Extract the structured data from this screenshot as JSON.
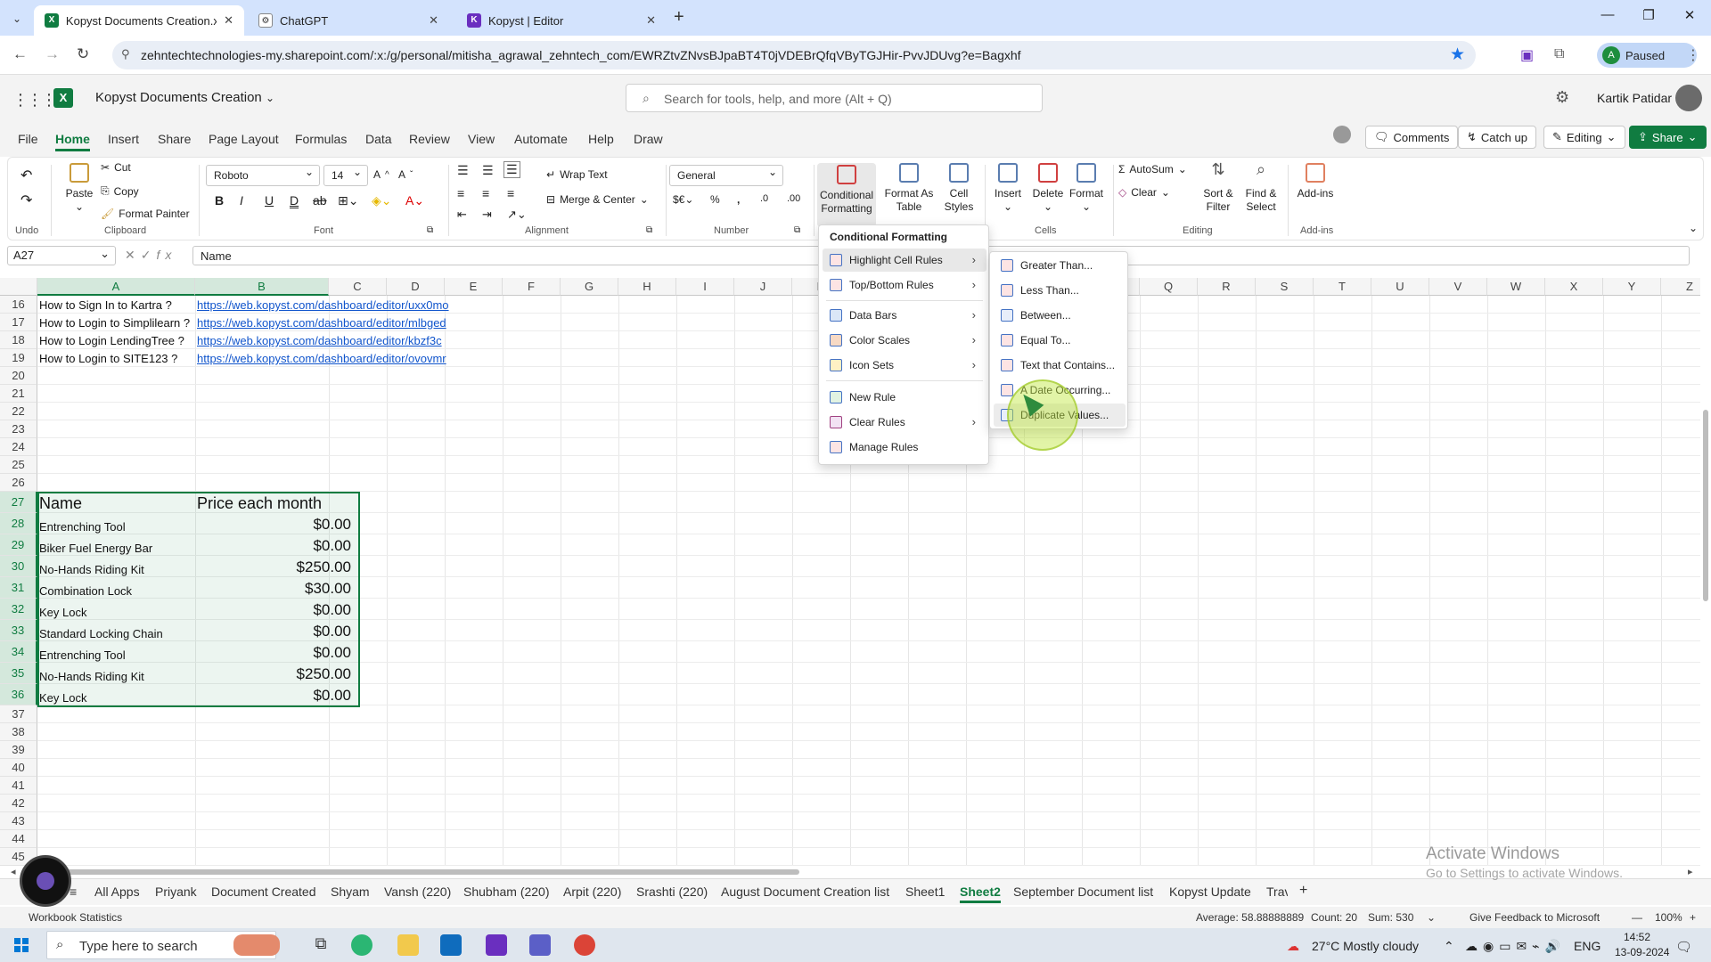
{
  "browser": {
    "tabs": [
      {
        "title": "Kopyst Documents Creation.xlsx",
        "active": true
      },
      {
        "title": "ChatGPT",
        "active": false
      },
      {
        "title": "Kopyst | Editor",
        "active": false
      }
    ],
    "url": "zehntechtechnologies-my.sharepoint.com/:x:/g/personal/mitisha_agrawal_zehntech_com/EWRZtvZNvsBJpaBT4T0jVDEBrQfqVByTGJHir-PvvJDUvg?e=Bagxhf",
    "profile_status": "Paused",
    "profile_initial": "A"
  },
  "app": {
    "title": "Kopyst Documents Creation",
    "search_placeholder": "Search for tools, help, and more (Alt + Q)",
    "user_name": "Kartik Patidar",
    "menu_tabs": [
      "File",
      "Home",
      "Insert",
      "Share",
      "Page Layout",
      "Formulas",
      "Data",
      "Review",
      "View",
      "Automate",
      "Help",
      "Draw"
    ],
    "active_tab": "Home",
    "comments_label": "Comments",
    "catchup_label": "Catch up",
    "editing_label": "Editing",
    "share_label": "Share"
  },
  "ribbon": {
    "undo_group": "Undo",
    "paste": "Paste",
    "cut": "Cut",
    "copy": "Copy",
    "format_painter": "Format Painter",
    "clipboard_group": "Clipboard",
    "font_name": "Roboto",
    "font_size": "14",
    "font_group": "Font",
    "wrap_text": "Wrap Text",
    "merge_center": "Merge & Center",
    "alignment_group": "Alignment",
    "number_format": "General",
    "number_group": "Number",
    "conditional_formatting": "Conditional Formatting",
    "format_as_table": "Format As Table",
    "cell_styles": "Cell Styles",
    "insert": "Insert",
    "delete": "Delete",
    "format": "Format",
    "cells_group": "Cells",
    "autosum": "AutoSum",
    "clear": "Clear",
    "sort_filter": "Sort & Filter",
    "find_select": "Find & Select",
    "editing_group": "Editing",
    "addins": "Add-ins",
    "addins_group": "Add-ins"
  },
  "formula_bar": {
    "name_box": "A27",
    "content": "Name"
  },
  "grid": {
    "columns": [
      "A",
      "B",
      "C",
      "D",
      "E",
      "F",
      "G",
      "H",
      "I",
      "J",
      "K",
      "L",
      "M",
      "N",
      "O",
      "P",
      "Q",
      "R",
      "S",
      "T",
      "U",
      "V",
      "W",
      "X",
      "Y",
      "Z"
    ],
    "rows": [
      "16",
      "17",
      "18",
      "19",
      "20",
      "21",
      "22",
      "23",
      "24",
      "25",
      "26",
      "27",
      "28",
      "29",
      "30",
      "31",
      "32",
      "33",
      "34",
      "35",
      "36",
      "37",
      "38",
      "39",
      "40",
      "41",
      "42",
      "43",
      "44",
      "45"
    ],
    "link_rows": [
      {
        "label": "How to Sign In to Kartra ?",
        "url": "https://web.kopyst.com/dashboard/editor/uxx0mo"
      },
      {
        "label": "How to Login to Simplilearn ?",
        "url": "https://web.kopyst.com/dashboard/editor/mlbged"
      },
      {
        "label": "How to Login LendingTree ?",
        "url": "https://web.kopyst.com/dashboard/editor/kbzf3c"
      },
      {
        "label": "How to Login to SITE123 ?",
        "url": "https://web.kopyst.com/dashboard/editor/ovovmr"
      }
    ],
    "table_header": {
      "name": "Name",
      "price": "Price each month"
    },
    "table_rows": [
      {
        "name": "Entrenching Tool",
        "price": "$0.00"
      },
      {
        "name": "Biker Fuel Energy Bar",
        "price": "$0.00"
      },
      {
        "name": "No-Hands Riding Kit",
        "price": "$250.00"
      },
      {
        "name": "Combination Lock",
        "price": "$30.00"
      },
      {
        "name": "Key Lock",
        "price": "$0.00"
      },
      {
        "name": "Standard Locking Chain",
        "price": "$0.00"
      },
      {
        "name": "Entrenching Tool",
        "price": "$0.00"
      },
      {
        "name": "No-Hands Riding Kit",
        "price": "$250.00"
      },
      {
        "name": "Key Lock",
        "price": "$0.00"
      }
    ]
  },
  "cf_menu": {
    "header": "Conditional Formatting",
    "items": [
      {
        "label": "Highlight Cell Rules",
        "submenu": true
      },
      {
        "label": "Top/Bottom Rules",
        "submenu": true
      },
      {
        "label": "Data Bars",
        "submenu": true
      },
      {
        "label": "Color Scales",
        "submenu": true
      },
      {
        "label": "Icon Sets",
        "submenu": true
      },
      {
        "label": "New Rule",
        "submenu": false
      },
      {
        "label": "Clear Rules",
        "submenu": true
      },
      {
        "label": "Manage Rules",
        "submenu": false
      }
    ]
  },
  "highlight_submenu": {
    "items": [
      "Greater Than...",
      "Less Than...",
      "Between...",
      "Equal To...",
      "Text that Contains...",
      "A Date Occurring...",
      "Duplicate Values..."
    ]
  },
  "sheets": {
    "tabs": [
      "All Apps",
      "Priyank",
      "Document Created",
      "Shyam",
      "Vansh (220)",
      "Shubham (220)",
      "Arpit (220)",
      "Srashti (220)",
      "August Document Creation list",
      "Sheet1",
      "Sheet2",
      "September Document list",
      "Kopyst Update",
      "Trav"
    ],
    "active": "Sheet2"
  },
  "watermark": {
    "line1": "Activate Windows",
    "line2": "Go to Settings to activate Windows."
  },
  "status": {
    "left": "Workbook Statistics",
    "average": "Average: 58.88888889",
    "count": "Count: 20",
    "sum": "Sum: 530",
    "feedback": "Give Feedback to Microsoft",
    "zoom": "100%"
  },
  "taskbar": {
    "search_placeholder": "Type here to search",
    "weather": "27°C  Mostly cloudy",
    "lang": "ENG",
    "time": "14:52",
    "date": "13-09-2024"
  }
}
